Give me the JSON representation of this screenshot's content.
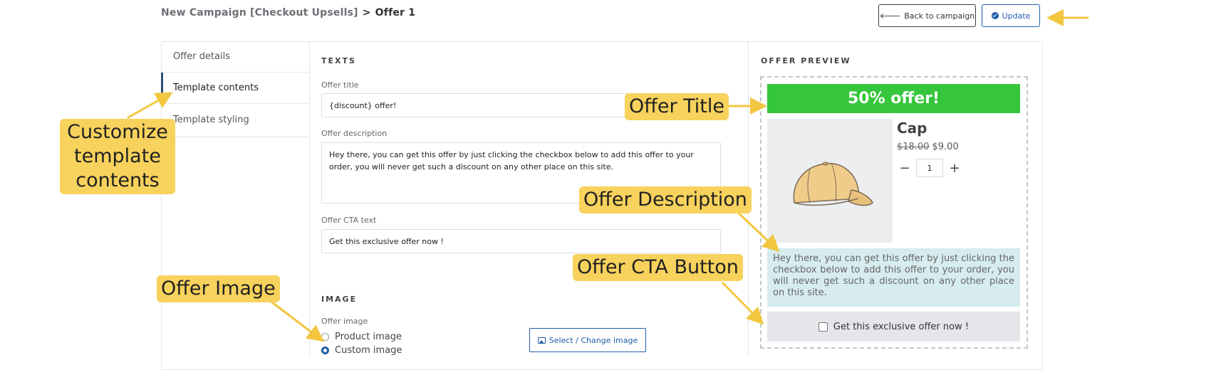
{
  "breadcrumb": {
    "root": "New Campaign [Checkout Upsells]",
    "separator": ">",
    "current": "Offer 1"
  },
  "header_actions": {
    "back_label": "Back to campaign",
    "update_label": "Update"
  },
  "nav": {
    "items": [
      {
        "label": "Offer details",
        "active": false
      },
      {
        "label": "Template contents",
        "active": true
      },
      {
        "label": "Template styling",
        "active": false
      }
    ]
  },
  "texts_section": {
    "heading": "TEXTS",
    "offer_title_label": "Offer title",
    "offer_title_value": "{discount} offer!",
    "offer_description_label": "Offer description",
    "offer_description_value": "Hey there, you can get this offer by just clicking the checkbox below to add this offer to your order, you will never get such a discount on any other place on this site.",
    "offer_cta_label": "Offer CTA text",
    "offer_cta_value": "Get this exclusive offer now !"
  },
  "image_section": {
    "heading": "IMAGE",
    "offer_image_label": "Offer image",
    "options": [
      {
        "label": "Product image",
        "selected": false
      },
      {
        "label": "Custom image",
        "selected": true
      }
    ],
    "select_button_label": "Select / Change image"
  },
  "preview": {
    "heading": "OFFER PREVIEW",
    "title": "50% offer!",
    "product_name": "Cap",
    "price_old": "$18.00",
    "price_new": "$9.00",
    "quantity": "1",
    "qty_minus": "−",
    "qty_plus": "+",
    "description": "Hey there, you can get this offer by just clicking the checkbox below to add this offer to your order, you will never get such a discount on any other place on this site.",
    "cta_text": "Get this exclusive offer now !",
    "title_bar_color": "#35c63b",
    "description_bg_color": "#d6ecef"
  },
  "annotations": {
    "customize": "Customize template contents",
    "offer_title": "Offer Title",
    "offer_description": "Offer Description",
    "offer_cta": "Offer CTA Button",
    "offer_image": "Offer Image",
    "callout_color": "#f7d25c"
  }
}
